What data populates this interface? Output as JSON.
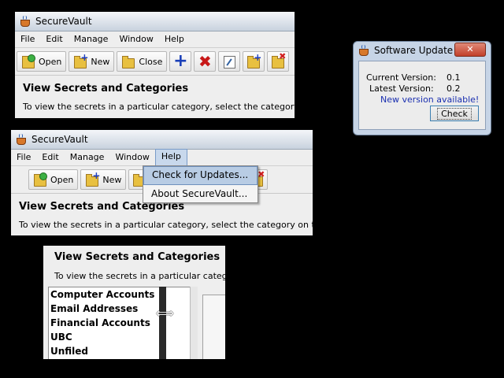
{
  "win1": {
    "title": "SecureVault",
    "menu": [
      "File",
      "Edit",
      "Manage",
      "Window",
      "Help"
    ],
    "toolbar": {
      "open": "Open",
      "new": "New",
      "close": "Close"
    },
    "heading": "View Secrets and Categories",
    "desc": "To view the secrets in a particular category, select the category on the"
  },
  "update": {
    "title": "Software Update",
    "close_glyph": "✕",
    "current_label": "Current Version:",
    "current_value": "0.1",
    "latest_label": "Latest Version:",
    "latest_value": "0.2",
    "status": "New version available!",
    "check": "Check",
    "status_color": "#1a2fb0"
  },
  "win2": {
    "title": "SecureVault",
    "menu": [
      "File",
      "Edit",
      "Manage",
      "Window",
      "Help"
    ],
    "toolbar": {
      "open": "Open",
      "new": "New"
    },
    "heading": "View Secrets and Categories",
    "desc": "To view the secrets in a particular category, select the category on the left.",
    "help_menu": [
      "Check for Updates...",
      "About SecureVault..."
    ]
  },
  "panel3": {
    "heading": "View Secrets and Categories",
    "desc": "To view the secrets in a particular category, s",
    "categories": [
      "Computer Accounts",
      "Email Addresses",
      "Financial Accounts",
      "UBC",
      "Unfiled"
    ],
    "cursor_glyph": "⟺"
  }
}
